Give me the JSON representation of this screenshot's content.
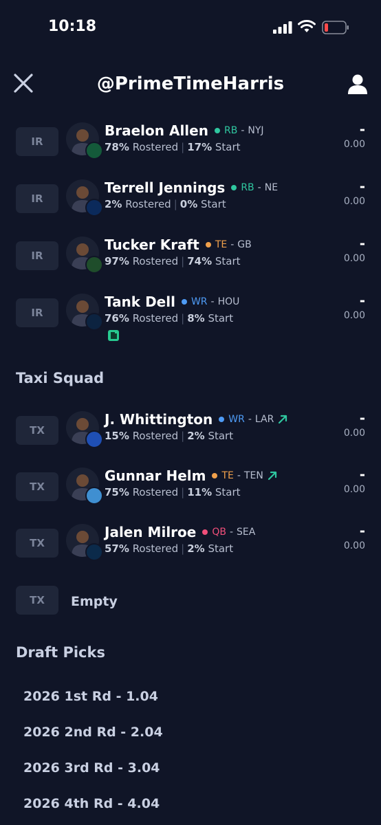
{
  "status": {
    "time": "10:18"
  },
  "header": {
    "title": "@PrimeTimeHarris"
  },
  "ir_players": [
    {
      "slot": "IR",
      "name": "Braelon Allen",
      "position": "RB",
      "pos_color": "#2fc7a0",
      "team": "NYJ",
      "team_color": "#145a3a",
      "rostered_pct": "78%",
      "rostered_label": "Rostered",
      "start_pct": "17%",
      "start_label": "Start",
      "projection": "-",
      "points": "0.00"
    },
    {
      "slot": "IR",
      "name": "Terrell Jennings",
      "position": "RB",
      "pos_color": "#2fc7a0",
      "team": "NE",
      "team_color": "#0b2a5b",
      "rostered_pct": "2%",
      "rostered_label": "Rostered",
      "start_pct": "0%",
      "start_label": "Start",
      "projection": "-",
      "points": "0.00"
    },
    {
      "slot": "IR",
      "name": "Tucker Kraft",
      "position": "TE",
      "pos_color": "#f0a04b",
      "team": "GB",
      "team_color": "#1f4d2b",
      "rostered_pct": "97%",
      "rostered_label": "Rostered",
      "start_pct": "74%",
      "start_label": "Start",
      "projection": "-",
      "points": "0.00"
    },
    {
      "slot": "IR",
      "name": "Tank Dell",
      "position": "WR",
      "pos_color": "#4e9bf5",
      "team": "HOU",
      "team_color": "#0c2340",
      "rostered_pct": "76%",
      "rostered_label": "Rostered",
      "start_pct": "8%",
      "start_label": "Start",
      "projection": "-",
      "points": "0.00"
    }
  ],
  "taxi_section_title": "Taxi Squad",
  "taxi_players": [
    {
      "slot": "TX",
      "name": "J. Whittington",
      "position": "WR",
      "pos_color": "#4e9bf5",
      "team": "LAR",
      "team_color": "#1f4fb4",
      "rostered_pct": "15%",
      "rostered_label": "Rostered",
      "start_pct": "2%",
      "start_label": "Start",
      "projection": "-",
      "points": "0.00",
      "trend": "up"
    },
    {
      "slot": "TX",
      "name": "Gunnar Helm",
      "position": "TE",
      "pos_color": "#f0a04b",
      "team": "TEN",
      "team_color": "#3f8fd1",
      "rostered_pct": "75%",
      "rostered_label": "Rostered",
      "start_pct": "11%",
      "start_label": "Start",
      "projection": "-",
      "points": "0.00",
      "trend": "up"
    },
    {
      "slot": "TX",
      "name": "Jalen Milroe",
      "position": "QB",
      "pos_color": "#f04f7a",
      "team": "SEA",
      "team_color": "#0b2a4a",
      "rostered_pct": "57%",
      "rostered_label": "Rostered",
      "start_pct": "2%",
      "start_label": "Start",
      "projection": "-",
      "points": "0.00"
    }
  ],
  "taxi_empty": {
    "slot": "TX",
    "label": "Empty"
  },
  "draft_section_title": "Draft Picks",
  "draft_picks": [
    "2026 1st Rd - 1.04",
    "2026 2nd Rd - 2.04",
    "2026 3rd Rd - 3.04",
    "2026 4th Rd - 4.04"
  ],
  "icons": {
    "close": "close-icon",
    "profile": "user-icon",
    "trend": "trend-up-arrow-icon",
    "note": "news-note-icon"
  }
}
